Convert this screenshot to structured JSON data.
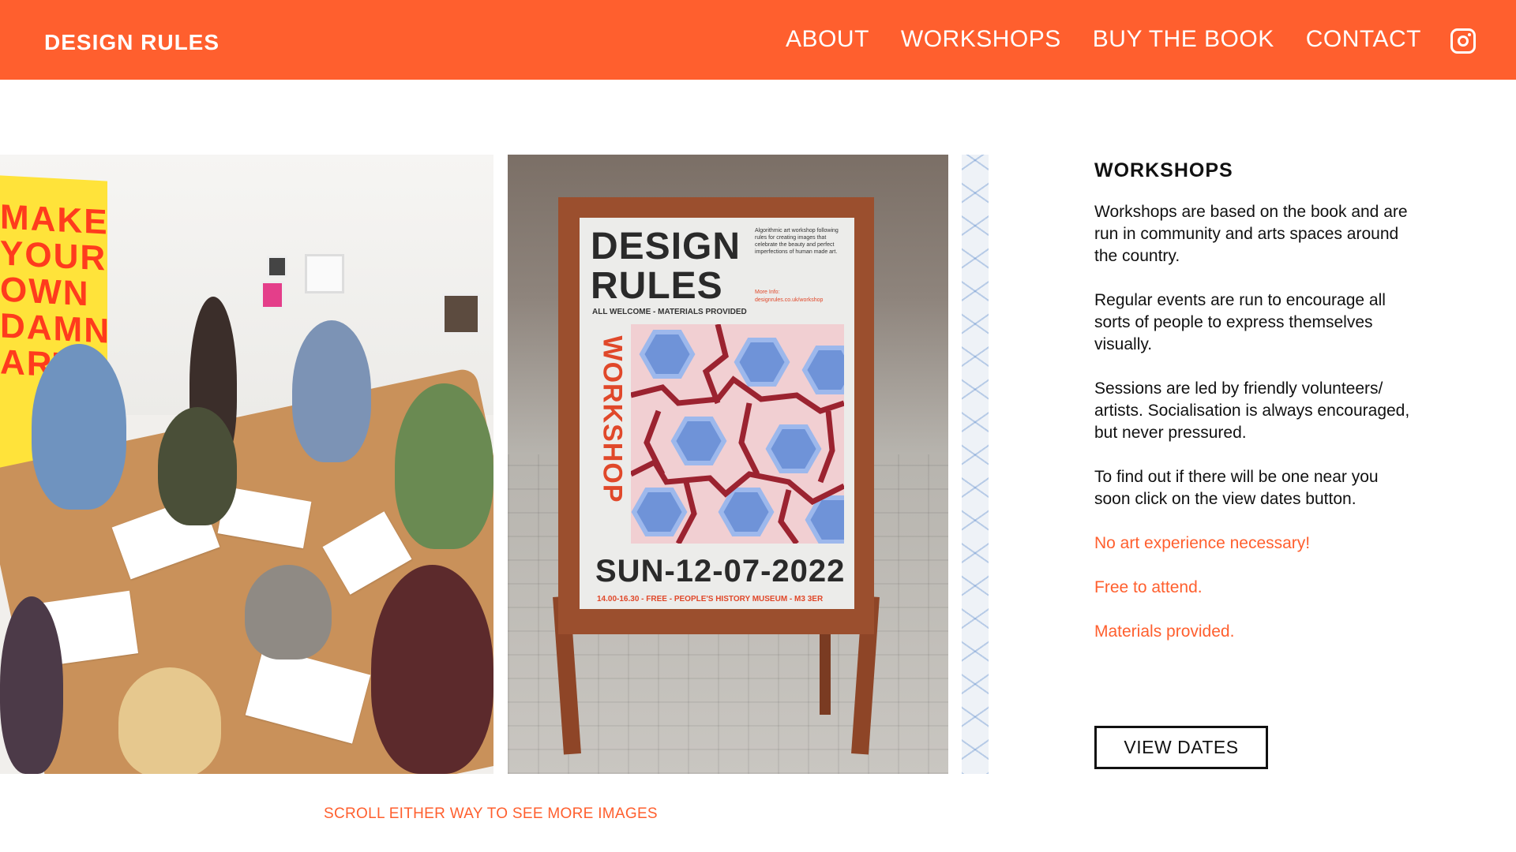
{
  "header": {
    "brand": "DESIGN RULES",
    "nav": [
      "ABOUT",
      "WORKSHOPS",
      "BUY THE BOOK",
      "CONTACT"
    ],
    "instagram_icon": "instagram-icon",
    "background_color": "#ff5f2e"
  },
  "gallery": {
    "banner_text": "MAKE YOUR OWN DAMN ART",
    "poster": {
      "title": "DESIGN RULES",
      "welcome": "ALL WELCOME - MATERIALS PROVIDED",
      "info": "Algorithmic art workshop following rules for creating images that celebrate the beauty and perfect imperfections of human made art.",
      "more_info": "More Info: designrules.co.uk/workshop",
      "side_text": "WORKSHOP",
      "date": "SUN-12-07-2022",
      "footer": "14.00-16.30 - FREE - PEOPLE'S HISTORY MUSEUM - M3 3ER"
    },
    "scroll_hint": "SCROLL EITHER WAY TO SEE MORE IMAGES"
  },
  "panel": {
    "heading": "WORKSHOPS",
    "paragraphs": [
      "Workshops are based on the book and are run in community and arts spaces around the country.",
      "Regular events are run to encourage all sorts of people to express themselves visually.",
      "Sessions are led by friendly volunteers/ artists. Socialisation is always encouraged, but never pressured.",
      "To find out if there will be one near you soon click on the view dates button."
    ],
    "highlights": [
      "No art experience necessary!",
      "Free to attend.",
      "Materials provided."
    ],
    "button_label": "VIEW DATES",
    "accent_color": "#ff5f2e"
  }
}
